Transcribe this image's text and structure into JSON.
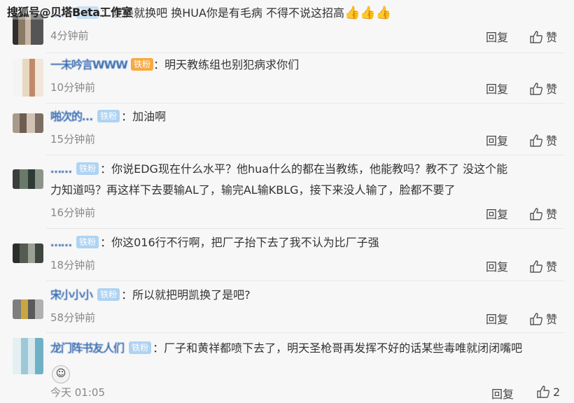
{
  "watermark": "搜狐号@贝塔Beta工作室",
  "comments": [
    {
      "user": "……",
      "badge": "铁粉",
      "text": "爱换就换吧 换HUA你是有毛病 不得不说这招高",
      "emoji": "👍👍👍",
      "time": "4分钟前",
      "reply": "回复",
      "like": "赞"
    },
    {
      "user": "一未吟言WWW",
      "badge_extra": "铁粉",
      "text": "明天教练组也别犯病求你们",
      "time": "10分钟前",
      "reply": "回复",
      "like": "赞"
    },
    {
      "user": "啪次的…",
      "badge": "铁粉",
      "text": "加油啊",
      "time": "15分钟前",
      "reply": "回复",
      "like": "赞"
    },
    {
      "user": "……",
      "badge": "铁粉",
      "text": "你说EDG现在什么水平？他hua什么的都在当教练，他能教吗？教不了 没这个能",
      "text2": "力知道吗？再这样下去要输AL了，输完AL输KBLG，接下来没人输了，脸都不要了",
      "time": "16分钟前",
      "reply": "回复",
      "like": "赞"
    },
    {
      "user": "……",
      "badge": "铁粉",
      "text": "你这016行不行啊，把厂子抬下去了我不认为比厂子强",
      "time": "18分钟前",
      "reply": "回复",
      "like": "赞"
    },
    {
      "user": "宋小小小",
      "badge": "铁粉",
      "text": "所以就把明凯换了是吧?",
      "time": "58分钟前",
      "reply": "回复",
      "like": "赞"
    },
    {
      "user": "龙门阵书友人们",
      "badge": "铁粉",
      "text": "厂子和黄祥都喷下去了，明天圣枪哥再发挥不好的话某些毒唯就闭闭嘴吧",
      "time": "今天 01:05",
      "reply": "回复",
      "like": "2"
    }
  ]
}
